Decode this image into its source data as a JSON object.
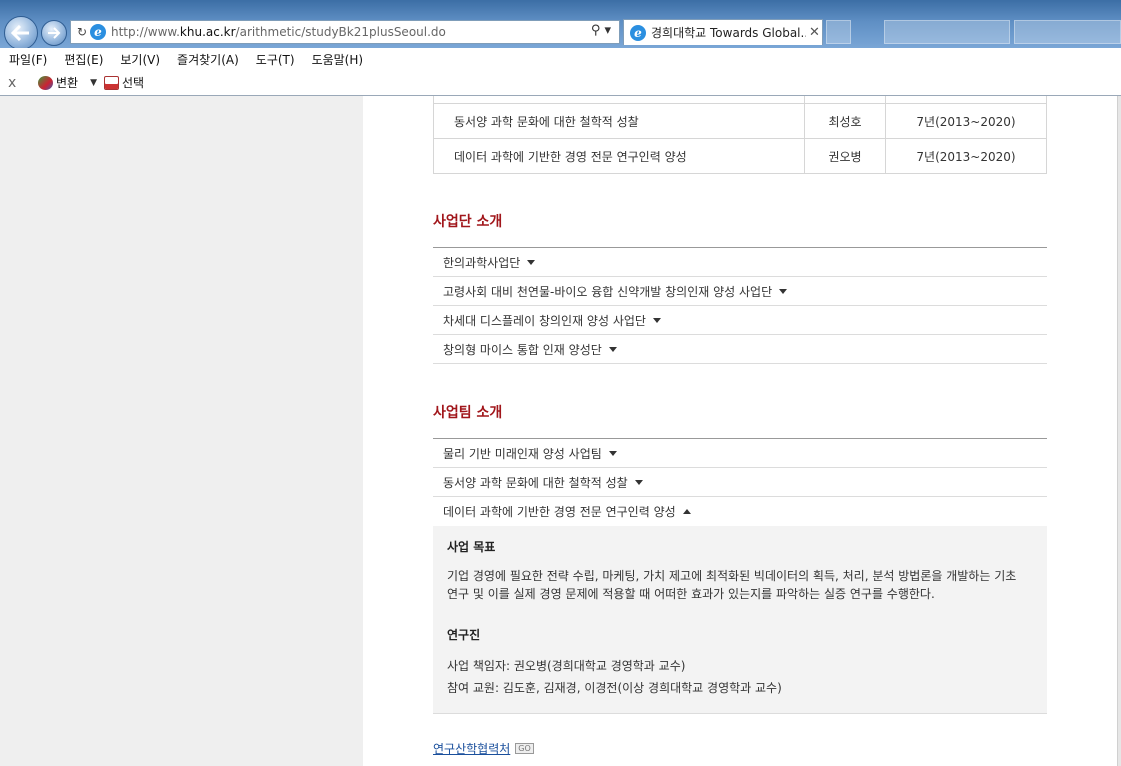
{
  "browser": {
    "url_prefix": "http://www.",
    "url_domain": "khu.ac.kr",
    "url_path": "/arithmetic/studyBk21plusSeoul.do",
    "tab_title": "경희대학교 Towards Global...",
    "menu": [
      "파일(F)",
      "편집(E)",
      "보기(V)",
      "즐겨찾기(A)",
      "도구(T)",
      "도움말(H)"
    ],
    "toolbar": {
      "close": "x",
      "convert": "변환",
      "select": "선택"
    }
  },
  "project_table": {
    "rows": [
      {
        "title": "",
        "lead": "",
        "period": ""
      },
      {
        "title": "동서양 과학 문화에 대한 철학적 성찰",
        "lead": "최성호",
        "period": "7년(2013~2020)"
      },
      {
        "title": "데이터 과학에 기반한 경영 전문 연구인력 양성",
        "lead": "권오병",
        "period": "7년(2013~2020)"
      }
    ]
  },
  "section_groups": {
    "title": "사업단 소개",
    "items": [
      "한의과학사업단",
      "고령사회 대비 천연물-바이오 융합 신약개발 창의인재 양성 사업단",
      "차세대 디스플레이 창의인재 양성 사업단",
      "창의형 마이스 통합 인재 양성단"
    ]
  },
  "section_teams": {
    "title": "사업팀 소개",
    "items": [
      "물리 기반 미래인재 양성 사업팀",
      "동서양 과학 문화에 대한 철학적 성찰",
      "데이터 과학에 기반한 경영 전문 연구인력 양성"
    ],
    "expanded": {
      "goal_heading": "사업 목표",
      "goal_text_1": "기업 경영에 필요한 전략 수립, 마케팅, 가치 제고에 최적화된 빅데이터의 획득, 처리, 분석 방법론을 개발하는 기초",
      "goal_text_2": "연구 및 이를 실제 경영 문제에 적용할 때 어떠한 효과가 있는지를 파악하는 실증 연구를 수행한다.",
      "staff_heading": "연구진",
      "staff_lead": "사업 책임자: 권오병(경희대학교 경영학과 교수)",
      "staff_members": "참여 교원: 김도훈, 김재경, 이경전(이상 경희대학교 경영학과 교수)"
    }
  },
  "footer_link": {
    "label": "연구산학협력처",
    "badge": "GO"
  },
  "icons": [
    "back-arrow-icon",
    "forward-arrow-icon",
    "refresh-icon",
    "ie-logo-icon",
    "search-icon",
    "close-icon",
    "dropdown-icon",
    "caret-down-icon",
    "caret-up-icon"
  ],
  "colors": {
    "section_title": "#a1161b",
    "link": "#1a4f9c",
    "panel_bg": "#f3f3f3",
    "left_gutter": "#efefef"
  }
}
